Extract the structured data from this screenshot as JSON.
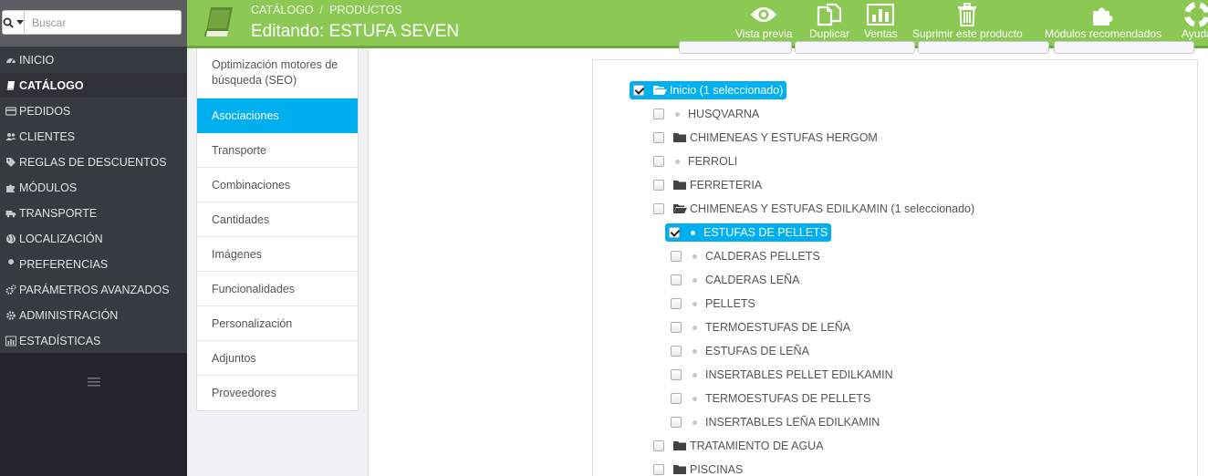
{
  "colors": {
    "header_green": "#8bc954",
    "sidebar_bg": "#363a41",
    "accent_blue": "#00aff0"
  },
  "search": {
    "placeholder": "Buscar"
  },
  "menu": [
    {
      "label": "INICIO",
      "icon": "dashboard-icon"
    },
    {
      "label": "CATÁLOGO",
      "icon": "book-icon",
      "active": true
    },
    {
      "label": "PEDIDOS",
      "icon": "credit-card-icon"
    },
    {
      "label": "CLIENTES",
      "icon": "users-icon"
    },
    {
      "label": "REGLAS DE DESCUENTOS",
      "icon": "tags-icon"
    },
    {
      "label": "MÓDULOS",
      "icon": "puzzle-icon"
    },
    {
      "label": "TRANSPORTE",
      "icon": "truck-icon"
    },
    {
      "label": "LOCALIZACIÓN",
      "icon": "globe-icon"
    },
    {
      "label": "PREFERENCIAS",
      "icon": "wrench-icon"
    },
    {
      "label": "PARÁMETROS AVANZADOS",
      "icon": "cogs-icon"
    },
    {
      "label": "ADMINISTRACIÓN",
      "icon": "cog-icon"
    },
    {
      "label": "ESTADÍSTICAS",
      "icon": "bar-chart-icon"
    }
  ],
  "header": {
    "breadcrumb": [
      "CATÁLOGO",
      "PRODUCTOS"
    ],
    "separator": "/",
    "title": "Editando: ESTUFA SEVEN"
  },
  "toolbar": [
    {
      "label": "Vista previa",
      "icon": "eye-icon"
    },
    {
      "label": "Duplicar",
      "icon": "copy-icon"
    },
    {
      "label": "Ventas",
      "icon": "bar-chart-icon"
    },
    {
      "label": "Suprimir este producto",
      "icon": "trash-icon"
    },
    {
      "label": "Módulos recomendados",
      "icon": "puzzle-icon"
    },
    {
      "label": "Ayuda",
      "icon": "lifebuoy-icon"
    }
  ],
  "tabs": [
    {
      "label": "Optimización motores de búsqueda (SEO)"
    },
    {
      "label": "Asociaciones",
      "active": true
    },
    {
      "label": "Transporte"
    },
    {
      "label": "Combinaciones"
    },
    {
      "label": "Cantidades"
    },
    {
      "label": "Imágenes"
    },
    {
      "label": "Funcionalidades"
    },
    {
      "label": "Personalización"
    },
    {
      "label": "Adjuntos"
    },
    {
      "label": "Proveedores"
    }
  ],
  "category_tree": [
    {
      "label": "Inicio (1 seleccionado)",
      "type": "folder-open",
      "checked": true,
      "selected": true,
      "level": 0
    },
    {
      "label": "HUSQVARNA",
      "type": "leaf",
      "checked": false,
      "level": 1
    },
    {
      "label": "CHIMENEAS Y ESTUFAS HERGOM",
      "type": "folder",
      "checked": false,
      "level": 1
    },
    {
      "label": "FERROLI",
      "type": "leaf",
      "checked": false,
      "level": 1
    },
    {
      "label": "FERRETERIA",
      "type": "folder",
      "checked": false,
      "level": 1
    },
    {
      "label": "CHIMENEAS Y ESTUFAS EDILKAMIN (1 seleccionado)",
      "type": "folder-open",
      "checked": false,
      "level": 1
    },
    {
      "label": "ESTUFAS DE PELLETS",
      "type": "leaf",
      "checked": true,
      "selected": true,
      "level": 2
    },
    {
      "label": "CALDERAS PELLETS",
      "type": "leaf",
      "checked": false,
      "level": 2
    },
    {
      "label": "CALDERAS LEÑA",
      "type": "leaf",
      "checked": false,
      "level": 2
    },
    {
      "label": "PELLETS",
      "type": "leaf",
      "checked": false,
      "level": 2
    },
    {
      "label": "TERMOESTUFAS DE LEÑA",
      "type": "leaf",
      "checked": false,
      "level": 2
    },
    {
      "label": "ESTUFAS DE LEÑA",
      "type": "leaf",
      "checked": false,
      "level": 2
    },
    {
      "label": "INSERTABLES PELLET EDILKAMIN",
      "type": "leaf",
      "checked": false,
      "level": 2
    },
    {
      "label": "TERMOESTUFAS DE PELLETS",
      "type": "leaf",
      "checked": false,
      "level": 2
    },
    {
      "label": "INSERTABLES LEÑA EDILKAMIN",
      "type": "leaf",
      "checked": false,
      "level": 2
    },
    {
      "label": "TRATAMIENTO DE AGUA",
      "type": "folder",
      "checked": false,
      "level": 1
    },
    {
      "label": "PISCINAS",
      "type": "folder",
      "checked": false,
      "level": 1
    }
  ]
}
